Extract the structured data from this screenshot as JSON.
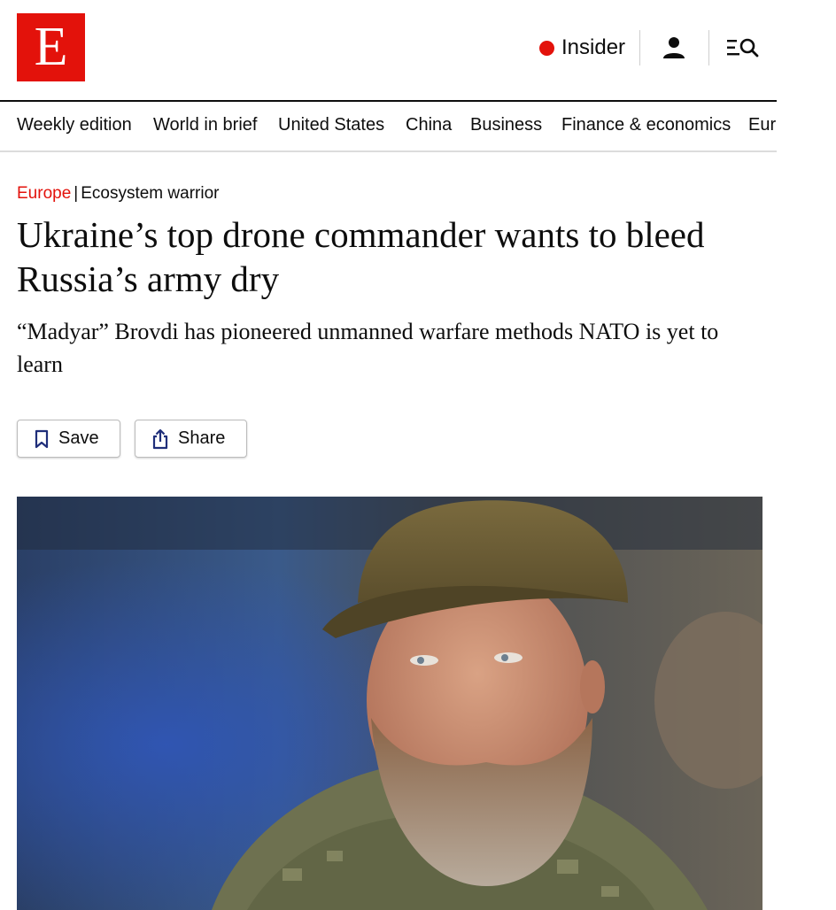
{
  "brand": {
    "logo_letter": "E",
    "accent": "#e3120b"
  },
  "header": {
    "insider_label": "Insider",
    "icons": [
      "account-icon",
      "menu-search-icon"
    ]
  },
  "nav": {
    "items": [
      {
        "label": "Weekly edition"
      },
      {
        "label": "World in brief"
      },
      {
        "label": "United States"
      },
      {
        "label": "China"
      },
      {
        "label": "Business"
      },
      {
        "label": "Finance & economics"
      },
      {
        "label": "Europe"
      }
    ]
  },
  "article": {
    "section": "Europe",
    "separator": "|",
    "rubric": "Ecosystem warrior",
    "headline": "Ukraine’s top drone commander wants to bleed Russia’s army dry",
    "subheadline": "“Madyar” Brovdi has pioneered unmanned warfare methods NATO is yet to learn"
  },
  "actions": {
    "save_label": "Save",
    "share_label": "Share"
  },
  "hero_image": {
    "subject": "photo-man-in-cap-and-camouflage"
  }
}
